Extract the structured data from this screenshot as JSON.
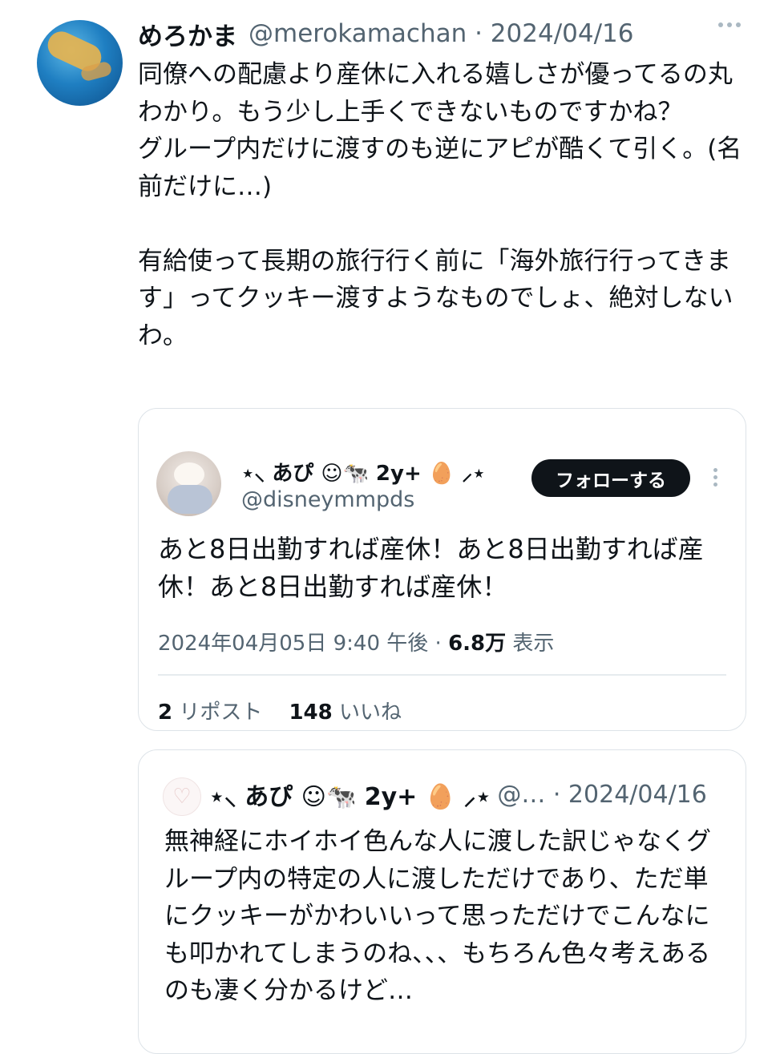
{
  "tweet": {
    "display_name": "めろかま",
    "handle_date": "@merokamachan · 2024/04/16",
    "paragraph_1": "同僚への配慮より産休に入れる嬉しさが優ってるの丸わかり。もう少し上手くできないものですかね？",
    "paragraph_2": "グループ内だけに渡すのも逆にアピが酷くて引く。(名前だけに…)",
    "paragraph_3": "有給使って長期の旅行行く前に「海外旅行行ってきます」ってクッキー渡すようなものでしょ、絶対しないわ。"
  },
  "quoted_tweet": {
    "display_name": "⋆⸜ あぴ ☺︎🐄 2y+ 🥚 ⸝⋆",
    "handle": "@disneymmpds",
    "follow_label": "フォローする",
    "text": "あと8日出勤すれば産休！あと8日出勤すれば産休！あと8日出勤すれば産休！",
    "timestamp": "2024年04月05日 9:40 午後",
    "views_count": "6.8万",
    "views_label": "表示",
    "reposts_count": "2",
    "reposts_label": "リポスト",
    "likes_count": "148",
    "likes_label": "いいね"
  },
  "reply_preview": {
    "display_name": "⋆⸜ あぴ ☺︎🐄 2y+ 🥚 ⸝⋆",
    "handle_date": "@… · 2024/04/16",
    "text": "無神経にホイホイ色んな人に渡した訳じゃなくグループ内の特定の人に渡しただけであり、ただ単にクッキーがかわいいって思っただけでこんなにも叩かれてしまうのね、、、もちろん色々考えあるのも凄く分かるけど…"
  }
}
